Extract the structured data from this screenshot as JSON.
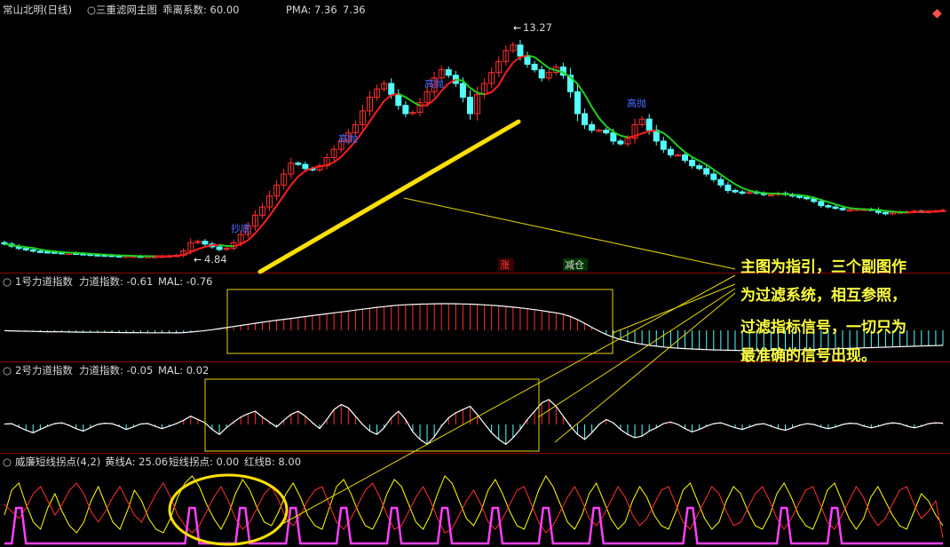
{
  "header": {
    "title": "常山北明(日线)",
    "indicator": "三重滤网主图",
    "deviation_label": "乖离系数: 60.00",
    "pma_label": "PMA: 7.36",
    "pma_value": "7.36"
  },
  "main_panel": {
    "high_label": "13.27",
    "low_label": "4.84",
    "tags": [
      "高抛",
      "高抛",
      "高抛",
      "抄底"
    ],
    "badges": [
      "涨",
      "减仓"
    ]
  },
  "panel1": {
    "name": "1号力道指数",
    "line_label": "力道指数: -0.61",
    "ma_label": "MAL: -0.76"
  },
  "panel2": {
    "name": "2号力道指数",
    "line_label": "力道指数: -0.05",
    "ma_label": "MAL: 0.02"
  },
  "panel3": {
    "name": "威廉短线拐点(4,2)",
    "yellow_label": "黄线A: 25.06",
    "magenta_label": "短线拐点: 0.00",
    "red_label": "红线B: 8.00"
  },
  "annotation": {
    "lines": [
      "主图为指引，三个副图作",
      "为过滤系统，相互参照，",
      "过滤指标信号，一切只为",
      "最准确的信号出现。"
    ]
  },
  "colors": {
    "up": "#ff3030",
    "down": "#54ffff",
    "ma_up": "#ff2020",
    "ma_down": "#20d020",
    "yellow": "#ffff00",
    "magenta": "#ff40ff",
    "grid": "#7a0000"
  },
  "chart_data": [
    {
      "type": "candlestick",
      "title": "三重滤网主图",
      "high": 13.27,
      "low": 4.84,
      "close": [
        5.45,
        5.37,
        5.29,
        5.24,
        5.19,
        5.17,
        5.16,
        5.14,
        5.12,
        5.12,
        5.1,
        5.08,
        5.06,
        5.05,
        5.04,
        5.02,
        5.01,
        5.01,
        5.01,
        5.0,
        5.0,
        5.0,
        5.01,
        5.02,
        5.04,
        5.2,
        5.5,
        5.55,
        5.45,
        5.35,
        5.25,
        5.3,
        5.5,
        5.8,
        6.1,
        6.5,
        6.8,
        7.2,
        7.6,
        8.0,
        8.4,
        8.35,
        8.2,
        8.15,
        8.3,
        8.6,
        8.9,
        9.2,
        9.5,
        9.8,
        10.3,
        10.8,
        11.1,
        11.3,
        10.9,
        10.5,
        10.2,
        10.25,
        10.6,
        11.0,
        11.5,
        11.8,
        11.6,
        11.3,
        10.8,
        10.2,
        10.9,
        11.3,
        11.7,
        12.1,
        12.5,
        12.7,
        12.3,
        12.0,
        11.8,
        11.5,
        11.7,
        11.9,
        11.6,
        11.0,
        10.2,
        9.8,
        9.6,
        9.6,
        9.5,
        9.2,
        9.1,
        9.3,
        9.8,
        10.0,
        9.6,
        9.2,
        8.9,
        8.7,
        8.7,
        8.5,
        8.3,
        8.2,
        8.0,
        7.8,
        7.6,
        7.4,
        7.35,
        7.3,
        7.35,
        7.3,
        7.25,
        7.25,
        7.3,
        7.25,
        7.2,
        7.15,
        7.1,
        7.0,
        6.85,
        6.8,
        6.75,
        6.7,
        6.7,
        6.72,
        6.72,
        6.7,
        6.6,
        6.55,
        6.6,
        6.62,
        6.63,
        6.65,
        6.64,
        6.64,
        6.66,
        6.68
      ]
    },
    {
      "type": "bar",
      "title": "1号力道指数",
      "series": [
        {
          "name": "力道指数",
          "values": [
            -0.05,
            -0.07,
            -0.1,
            -0.12,
            -0.14,
            -0.16,
            -0.18,
            -0.19,
            -0.2,
            -0.22,
            -0.23,
            -0.24,
            -0.25,
            -0.26,
            -0.27,
            -0.28,
            -0.29,
            -0.3,
            -0.3,
            -0.31,
            -0.32,
            -0.32,
            -0.33,
            -0.33,
            -0.34,
            -0.3,
            -0.22,
            -0.14,
            -0.04,
            0.08,
            0.22,
            0.36,
            0.5,
            0.64,
            0.78,
            0.92,
            1.06,
            1.2,
            1.32,
            1.44,
            1.56,
            1.68,
            1.8,
            1.92,
            2.04,
            2.16,
            2.28,
            2.4,
            2.52,
            2.64,
            2.76,
            2.88,
            3.0,
            3.1,
            3.2,
            3.28,
            3.34,
            3.38,
            3.42,
            3.45,
            3.47,
            3.48,
            3.48,
            3.47,
            3.45,
            3.42,
            3.38,
            3.33,
            3.27,
            3.2,
            3.12,
            3.03,
            2.93,
            2.82,
            2.7,
            2.57,
            2.43,
            2.28,
            2.1,
            1.8,
            1.4,
            0.9,
            0.4,
            -0.1,
            -0.55,
            -0.9,
            -1.2,
            -1.45,
            -1.65,
            -1.82,
            -1.96,
            -2.08,
            -2.18,
            -2.26,
            -2.33,
            -2.39,
            -2.44,
            -2.48,
            -2.52,
            -2.55,
            -2.58,
            -2.6,
            -2.62,
            -2.63,
            -2.64,
            -2.64,
            -2.63,
            -2.62,
            -2.6,
            -2.58,
            -2.56,
            -2.54,
            -2.52,
            -2.5,
            -2.47,
            -2.44,
            -2.41,
            -2.38,
            -2.35,
            -2.32,
            -2.29,
            -2.26,
            -2.23,
            -2.2,
            -2.17,
            -2.14,
            -2.11,
            -2.08,
            -2.05,
            -2.02,
            -1.99,
            -1.96
          ]
        }
      ]
    },
    {
      "type": "bar",
      "title": "2号力道指数",
      "series": [
        {
          "name": "力道指数",
          "values": [
            0.05,
            0.1,
            -0.3,
            -0.7,
            -1.0,
            -0.6,
            -0.2,
            0.1,
            0.2,
            -0.1,
            -0.5,
            -0.8,
            -0.4,
            0.0,
            0.15,
            0.1,
            -0.2,
            -0.6,
            -0.3,
            0.05,
            0.12,
            -0.2,
            -0.5,
            -0.2,
            0.1,
            0.5,
            1.0,
            0.6,
            0.2,
            -0.6,
            -1.2,
            -0.4,
            0.3,
            0.9,
            1.3,
            1.6,
            0.9,
            0.3,
            -0.3,
            0.5,
            1.2,
            1.6,
            1.0,
            0.2,
            -0.5,
            0.6,
            1.8,
            2.4,
            2.0,
            1.0,
            0.0,
            -0.8,
            -1.2,
            -0.4,
            0.8,
            1.6,
            0.6,
            -0.9,
            -1.8,
            -2.4,
            -1.5,
            -0.2,
            0.8,
            1.4,
            1.8,
            2.2,
            1.2,
            0.1,
            -1.0,
            -1.8,
            -2.4,
            -1.6,
            -0.6,
            0.6,
            1.6,
            2.6,
            3.0,
            2.2,
            1.0,
            -0.2,
            -1.2,
            -1.8,
            -1.0,
            0.0,
            0.6,
            0.2,
            -0.6,
            -1.2,
            -1.6,
            -1.4,
            -0.8,
            -0.4,
            0.1,
            0.3,
            0.0,
            -0.5,
            -0.9,
            -0.6,
            -0.2,
            0.1,
            0.2,
            -0.1,
            -0.4,
            -0.6,
            -0.3,
            0.0,
            0.1,
            -0.2,
            -0.5,
            -0.7,
            -0.4,
            -0.1,
            0.1,
            0.0,
            -0.3,
            -0.5,
            -0.3,
            0.0,
            0.15,
            0.1,
            -0.2,
            -0.4,
            -0.2,
            0.05,
            0.2,
            0.1,
            -0.2,
            -0.4,
            -0.2,
            0.1,
            0.2,
            0.15
          ]
        }
      ]
    },
    {
      "type": "line",
      "title": "威廉短线拐点(4,2)",
      "series": [
        {
          "name": "黄线A",
          "values": [
            40,
            75,
            85,
            55,
            30,
            20,
            50,
            70,
            45,
            25,
            15,
            30,
            60,
            80,
            55,
            30,
            20,
            45,
            75,
            60,
            35,
            20,
            15,
            35,
            65,
            85,
            95,
            80,
            55,
            35,
            20,
            40,
            70,
            90,
            75,
            50,
            30,
            25,
            45,
            70,
            85,
            65,
            40,
            25,
            20,
            50,
            80,
            90,
            70,
            45,
            25,
            20,
            40,
            70,
            90,
            80,
            55,
            30,
            20,
            40,
            70,
            95,
            85,
            60,
            35,
            25,
            45,
            75,
            90,
            70,
            45,
            25,
            20,
            45,
            75,
            95,
            80,
            55,
            30,
            20,
            40,
            70,
            85,
            60,
            35,
            20,
            30,
            60,
            80,
            65,
            40,
            25,
            20,
            45,
            75,
            85,
            60,
            35,
            20,
            30,
            60,
            80,
            70,
            45,
            25,
            20,
            40,
            70,
            85,
            65,
            40,
            25,
            20,
            45,
            75,
            85,
            60,
            35,
            20,
            35,
            65,
            80,
            60,
            40,
            25,
            20,
            45,
            70,
            60,
            40,
            25
          ]
        },
        {
          "name": "短线拐点",
          "values": [
            0,
            0,
            0,
            0,
            0,
            0,
            0,
            0,
            0,
            0,
            0,
            0,
            0,
            0,
            0,
            0,
            0,
            0,
            0,
            0,
            0,
            0,
            0,
            0,
            0,
            0,
            0,
            0,
            0,
            0,
            0,
            0,
            0,
            0,
            0,
            0,
            0,
            0,
            0,
            0,
            0,
            0,
            0,
            0,
            0,
            0,
            0,
            0,
            0,
            0,
            0,
            0,
            0,
            0,
            0,
            0,
            0,
            0,
            0,
            0,
            0,
            0,
            0,
            0,
            0,
            0,
            0,
            0,
            0,
            0,
            0,
            0,
            0,
            0,
            0,
            0,
            0,
            0,
            0,
            0,
            0,
            0,
            0,
            0,
            0,
            0,
            0,
            0,
            0,
            0,
            0,
            0,
            0,
            0,
            0,
            0,
            0,
            0,
            0,
            0,
            0,
            0,
            0,
            0,
            0,
            0,
            0,
            0,
            0,
            0,
            0,
            0,
            0,
            0,
            0,
            0,
            0,
            0,
            0,
            0,
            0,
            0,
            0,
            0,
            0,
            0,
            0,
            0,
            0,
            0,
            0,
            0
          ]
        },
        {
          "name": "红线B",
          "values": [
            55,
            45,
            35,
            50,
            70,
            80,
            60,
            40,
            55,
            75,
            85,
            70,
            45,
            30,
            45,
            65,
            80,
            60,
            40,
            30,
            50,
            70,
            85,
            65,
            40,
            25,
            15,
            25,
            45,
            65,
            80,
            60,
            35,
            20,
            30,
            50,
            70,
            80,
            60,
            35,
            25,
            40,
            60,
            75,
            80,
            55,
            30,
            20,
            35,
            55,
            75,
            85,
            65,
            40,
            20,
            25,
            45,
            65,
            80,
            60,
            35,
            15,
            20,
            40,
            60,
            75,
            55,
            30,
            20,
            35,
            55,
            75,
            80,
            55,
            30,
            15,
            25,
            45,
            65,
            80,
            60,
            35,
            25,
            40,
            60,
            80,
            65,
            40,
            25,
            35,
            55,
            75,
            80,
            55,
            30,
            20,
            40,
            60,
            80,
            70,
            45,
            25,
            30,
            50,
            70,
            80,
            60,
            35,
            20,
            35,
            55,
            75,
            80,
            55,
            30,
            20,
            40,
            60,
            80,
            65,
            40,
            25,
            35,
            55,
            75,
            80,
            55,
            35,
            45,
            60,
            8
          ]
        }
      ]
    }
  ]
}
